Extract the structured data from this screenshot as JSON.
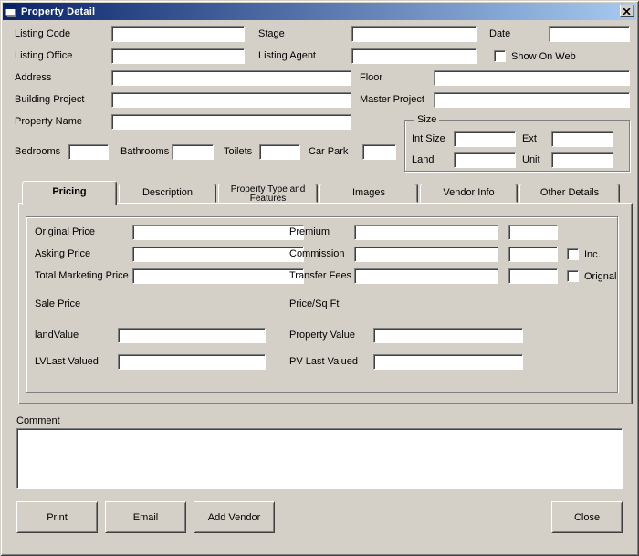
{
  "window": {
    "title": "Property Detail"
  },
  "fields": {
    "listing_code": {
      "label": "Listing Code",
      "value": ""
    },
    "stage": {
      "label": "Stage",
      "value": ""
    },
    "date": {
      "label": "Date",
      "value": ""
    },
    "listing_office": {
      "label": "Listing Office",
      "value": ""
    },
    "listing_agent": {
      "label": "Listing Agent",
      "value": ""
    },
    "show_on_web": {
      "label": "Show On Web",
      "checked": false
    },
    "address": {
      "label": "Address",
      "value": ""
    },
    "floor": {
      "label": "Floor",
      "value": ""
    },
    "building_project": {
      "label": "Building Project",
      "value": ""
    },
    "master_project": {
      "label": "Master Project",
      "value": ""
    },
    "property_name": {
      "label": "Property Name",
      "value": ""
    },
    "bedrooms": {
      "label": "Bedrooms",
      "value": ""
    },
    "bathrooms": {
      "label": "Bathrooms",
      "value": ""
    },
    "toilets": {
      "label": "Toilets",
      "value": ""
    },
    "car_park": {
      "label": "Car Park",
      "value": ""
    }
  },
  "size_group": {
    "title": "Size",
    "int_size": {
      "label": "Int Size",
      "value": ""
    },
    "ext": {
      "label": "Ext",
      "value": ""
    },
    "land": {
      "label": "Land",
      "value": ""
    },
    "unit": {
      "label": "Unit",
      "value": ""
    }
  },
  "tabs": [
    {
      "label": "Pricing",
      "selected": true
    },
    {
      "label": "Description",
      "selected": false
    },
    {
      "label": "Property Type and Features",
      "selected": false
    },
    {
      "label": "Images",
      "selected": false
    },
    {
      "label": "Vendor Info",
      "selected": false
    },
    {
      "label": "Other Details",
      "selected": false
    }
  ],
  "pricing": {
    "original_price": {
      "label": "Original Price",
      "value": ""
    },
    "premium": {
      "label": "Premium",
      "value": "",
      "extra": ""
    },
    "asking_price": {
      "label": "Asking Price",
      "value": ""
    },
    "commission": {
      "label": "Commission",
      "value": "",
      "extra": "",
      "inc_label": "Inc.",
      "inc_checked": false
    },
    "total_marketing_price": {
      "label": "Total Marketing Price",
      "value": ""
    },
    "transfer_fees": {
      "label": "Transfer Fees",
      "value": "",
      "extra": "",
      "orignal_label": "Orignal",
      "orignal_checked": false
    },
    "sale_price_label": "Sale Price",
    "price_sq_ft_label": "Price/Sq Ft",
    "land_value": {
      "label": "landValue",
      "value": ""
    },
    "property_value": {
      "label": "Property Value",
      "value": ""
    },
    "lv_last_valued": {
      "label": "LVLast Valued",
      "value": ""
    },
    "pv_last_valued": {
      "label": "PV Last Valued",
      "value": ""
    }
  },
  "comment": {
    "label": "Comment",
    "value": ""
  },
  "buttons": {
    "print": "Print",
    "email": "Email",
    "add_vendor": "Add Vendor",
    "close": "Close"
  },
  "colors": {
    "titlebar_start": "#0A246A",
    "titlebar_end": "#A6CAF0",
    "window_bg": "#D4D0C8",
    "field_bg": "#FFFFFF",
    "title_text": "#FFFFFF"
  }
}
